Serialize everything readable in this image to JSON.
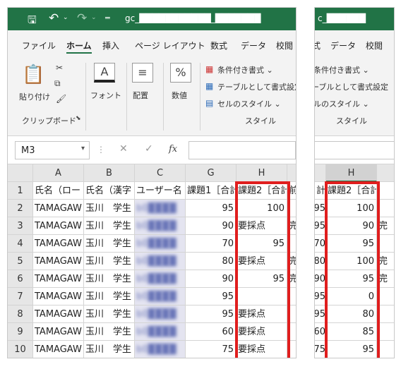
{
  "left": {
    "title": "gc_███████████_███████",
    "tabs": [
      "ファイル",
      "ホーム",
      "挿入",
      "ページ レイアウト",
      "数式",
      "データ",
      "校閲"
    ],
    "active_tab": "ホーム",
    "clipboard": {
      "paste": "貼り付け",
      "group": "クリップボード"
    },
    "font": {
      "label": "フォント"
    },
    "alignment": {
      "label": "配置"
    },
    "number": {
      "label": "数値"
    },
    "styles": {
      "conditional": "条件付き書式 ⌄",
      "table": "テーブルとして書式設定",
      "cell_style": "セルのスタイル ⌄",
      "group": "スタイル"
    },
    "namebox": "M3",
    "fx": "fx",
    "col_headers": [
      "A",
      "B",
      "C",
      "G",
      "H"
    ],
    "row_numbers": [
      "1",
      "2",
      "3",
      "4",
      "5",
      "6",
      "7",
      "8",
      "9",
      "10"
    ],
    "rows": [
      [
        "氏名（ロー",
        "氏名（漢字",
        "ユーザー名",
        "課題1［合計",
        "課題2［合計"
      ],
      [
        "TAMAGAW",
        "玉川　学生",
        "b0████",
        "95",
        "100"
      ],
      [
        "TAMAGAW",
        "玉川　学生",
        "b0████",
        "90",
        "要採点"
      ],
      [
        "TAMAGAW",
        "玉川　学生",
        "b0████",
        "70",
        "95"
      ],
      [
        "TAMAGAW",
        "玉川　学生",
        "b0████",
        "80",
        "要採点"
      ],
      [
        "TAMAGAW",
        "玉川　学生",
        "b0████",
        "90",
        "95"
      ],
      [
        "TAMAGAW",
        "玉川　学生",
        "b0████",
        "95",
        ""
      ],
      [
        "TAMAGAW",
        "玉川　学生",
        "b0████",
        "95",
        "要採点"
      ],
      [
        "TAMAGAW",
        "玉川　学生",
        "b0████",
        "60",
        "要採点"
      ],
      [
        "TAMAGAW",
        "玉川　学生",
        "b0████",
        "75",
        "要採点"
      ]
    ],
    "overflow": [
      "前",
      "",
      "完",
      "",
      "完",
      "完",
      "",
      "",
      "",
      ""
    ]
  },
  "right": {
    "title": "c_██████",
    "tabs": [
      "式",
      "データ",
      "校閲"
    ],
    "styles": {
      "conditional": "条件付き書式 ⌄",
      "table": "テーブルとして書式設定",
      "cell_style": "ルのスタイル ⌄",
      "group": "スタイル"
    },
    "col_header": "H",
    "g_cut": [
      "計",
      "95",
      "95",
      "70",
      "80",
      "90",
      "95",
      "95",
      "60",
      "75"
    ],
    "h_values": [
      "課題2［合計",
      "100",
      "90",
      "95",
      "100",
      "95",
      "0",
      "80",
      "85",
      "95"
    ],
    "overflow": [
      "",
      "",
      "完",
      "",
      "完",
      "完",
      "",
      "",
      "",
      ""
    ]
  },
  "colors": {
    "excel_green": "#217346",
    "highlight": "#e01e1e"
  }
}
